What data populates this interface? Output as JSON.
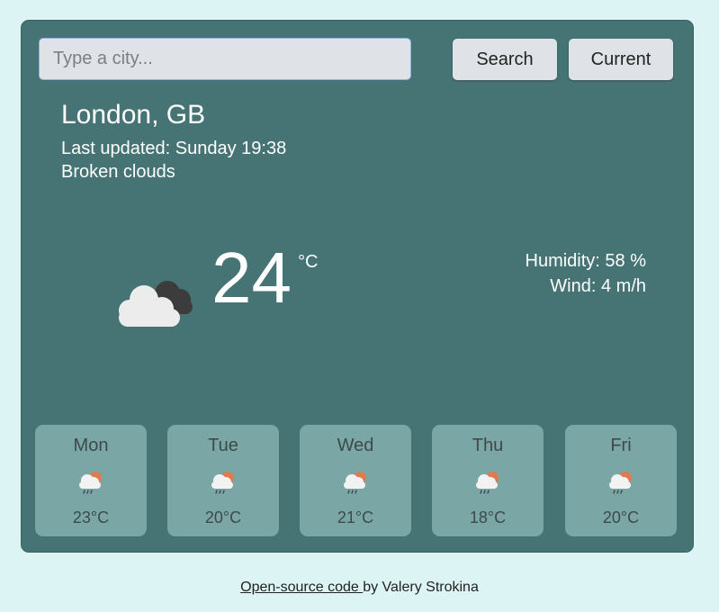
{
  "search": {
    "placeholder": "Type a city...",
    "value": "",
    "search_label": "Search",
    "current_label": "Current"
  },
  "current": {
    "city": "London, GB",
    "updated": "Last updated: Sunday 19:38",
    "description": "Broken clouds",
    "icon": "broken-clouds-icon",
    "temperature": "24",
    "unit": "°C",
    "humidity": "Humidity: 58 %",
    "wind": "Wind: 4 m/h"
  },
  "forecast": [
    {
      "day": "Mon",
      "temp": "23°C",
      "icon": "rain-sun-icon"
    },
    {
      "day": "Tue",
      "temp": "20°C",
      "icon": "rain-sun-icon"
    },
    {
      "day": "Wed",
      "temp": "21°C",
      "icon": "rain-sun-icon"
    },
    {
      "day": "Thu",
      "temp": "18°C",
      "icon": "rain-sun-icon"
    },
    {
      "day": "Fri",
      "temp": "20°C",
      "icon": "rain-sun-icon"
    }
  ],
  "footer": {
    "link_text": "Open-source code ",
    "author": "by Valery Strokina"
  },
  "colors": {
    "background": "#ddf4f4",
    "card": "#467373",
    "forecast_card": "#7aa6a6",
    "button": "#dfe3e7"
  }
}
